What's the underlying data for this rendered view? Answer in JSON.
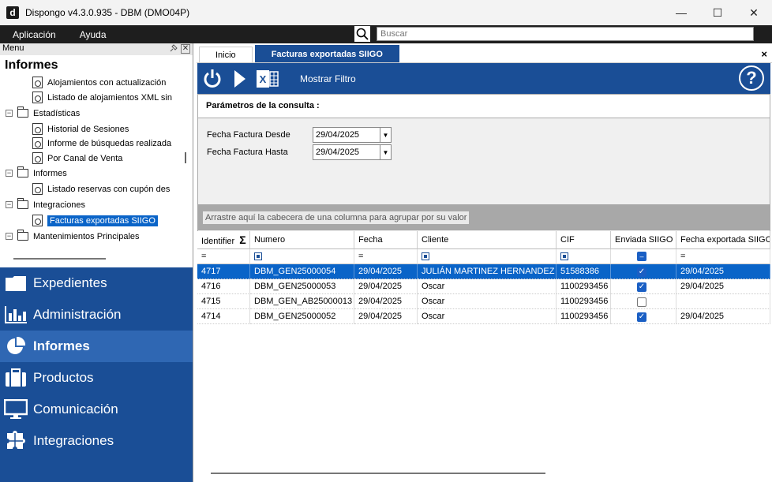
{
  "window": {
    "title": "Dispongo v4.3.0.935 - DBM (DMO04P)",
    "logo_letter": "d",
    "minimize": "—",
    "maximize": "☐",
    "close": "✕"
  },
  "menubar": {
    "items": [
      "Aplicación",
      "Ayuda"
    ],
    "search_placeholder": "Buscar"
  },
  "leftpane": {
    "header": "Menu",
    "section_title": "Informes",
    "tree": [
      {
        "label": "Alojamientos con actualización",
        "type": "doc"
      },
      {
        "label": "Listado de alojamientos XML sin",
        "type": "doc"
      },
      {
        "label": "Estadísticas",
        "type": "folder",
        "toggle": "−"
      },
      {
        "label": "Historial de Sesiones",
        "type": "doc"
      },
      {
        "label": "Informe de búsquedas realizada",
        "type": "doc"
      },
      {
        "label": "Por Canal de Venta",
        "type": "doc"
      },
      {
        "label": "Informes",
        "type": "folder",
        "toggle": "−"
      },
      {
        "label": "Listado reservas con cupón des",
        "type": "doc"
      },
      {
        "label": "Integraciones",
        "type": "folder",
        "toggle": "−"
      },
      {
        "label": "Facturas exportadas SIIGO",
        "type": "doc",
        "selected": true
      },
      {
        "label": "Mantenimientos Principales",
        "type": "folder",
        "toggle": "−"
      }
    ],
    "nav": [
      {
        "label": "Expedientes",
        "icon": "folder-icon"
      },
      {
        "label": "Administración",
        "icon": "bar-chart-icon"
      },
      {
        "label": "Informes",
        "icon": "pie-chart-icon",
        "active": true
      },
      {
        "label": "Productos",
        "icon": "suitcase-icon"
      },
      {
        "label": "Comunicación",
        "icon": "monitor-icon"
      },
      {
        "label": "Integraciones",
        "icon": "puzzle-icon"
      }
    ]
  },
  "tabs": [
    {
      "label": "Inicio"
    },
    {
      "label": "Facturas exportadas SIIGO",
      "active": true
    }
  ],
  "tab_close": "×",
  "toolbar": {
    "filter_label": "Mostrar Filtro",
    "help": "?"
  },
  "params": {
    "title": "Parámetros de la consulta :",
    "fecha_desde_label": "Fecha Factura Desde",
    "fecha_desde_value": "29/04/2025",
    "fecha_hasta_label": "Fecha Factura Hasta",
    "fecha_hasta_value": "29/04/2025"
  },
  "group_hint": "Arrastre aquí la cabecera de una columna para agrupar por su valor",
  "grid": {
    "columns": [
      "Identifier",
      "Numero",
      "Fecha",
      "Cliente",
      "CIF",
      "Enviada SIIGO",
      "Fecha exportada SIIGO"
    ],
    "sum_symbol": "Σ",
    "filter_eq": "=",
    "rows": [
      {
        "id": "4717",
        "numero": "DBM_GEN25000054",
        "fecha": "29/04/2025",
        "cliente": "JULIÁN MARTINEZ HERNANDEZ",
        "cif": "51588386",
        "enviada": true,
        "fecha_exp": "29/04/2025",
        "selected": true
      },
      {
        "id": "4716",
        "numero": "DBM_GEN25000053",
        "fecha": "29/04/2025",
        "cliente": "Oscar",
        "cif": "1100293456",
        "enviada": true,
        "fecha_exp": "29/04/2025"
      },
      {
        "id": "4715",
        "numero": "DBM_GEN_AB25000013",
        "fecha": "29/04/2025",
        "cliente": "Oscar",
        "cif": "1100293456",
        "enviada": false,
        "fecha_exp": ""
      },
      {
        "id": "4714",
        "numero": "DBM_GEN25000052",
        "fecha": "29/04/2025",
        "cliente": "Oscar",
        "cif": "1100293456",
        "enviada": true,
        "fecha_exp": "29/04/2025"
      }
    ]
  },
  "colors": {
    "accent": "#1a4e96",
    "selected_row": "#0a64c8",
    "nav_active": "#2f67b3"
  }
}
